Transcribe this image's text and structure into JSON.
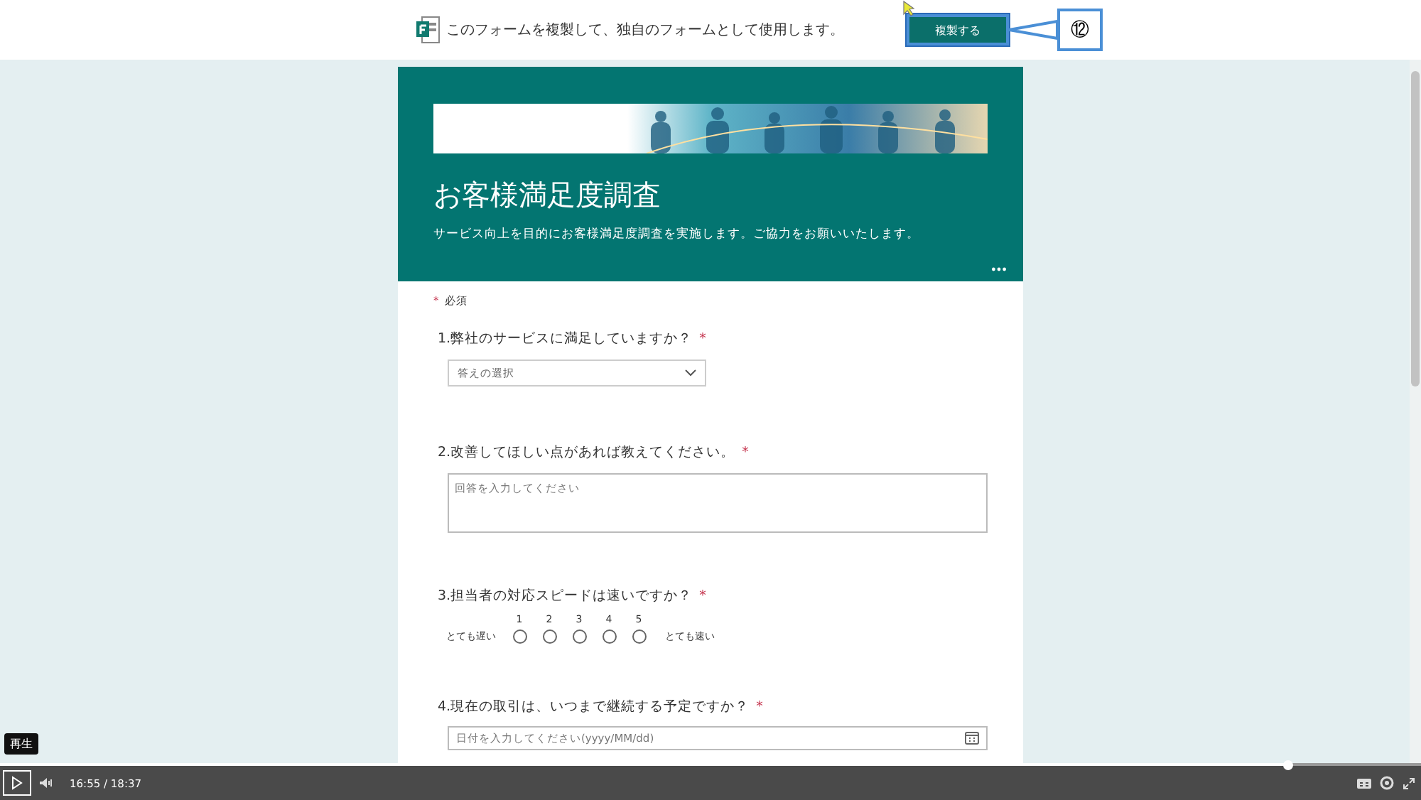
{
  "banner": {
    "text": "このフォームを複製して、独自のフォームとして使用します。",
    "button": "複製する",
    "callout": "⑫"
  },
  "form": {
    "title": "お客様満足度調査",
    "description": "サービス向上を目的にお客様満足度調査を実施します。ご協力をお願いいたします。",
    "required_note": {
      "mark": "*",
      "text": "必須"
    },
    "questions": [
      {
        "kind": "dropdown",
        "text": "1.弊社のサービスに満足していますか？",
        "mark": "*",
        "placeholder": "答えの選択"
      },
      {
        "kind": "textarea",
        "text": "2.改善してほしい点があれば教えてください。",
        "mark": "*",
        "placeholder": "回答を入力してください"
      },
      {
        "kind": "rating",
        "text": "3.担当者の対応スピードは速いですか？",
        "mark": "*",
        "low": "とても遅い",
        "high": "とても速い",
        "options": [
          {
            "label": "1",
            "selected": false
          },
          {
            "label": "2",
            "selected": false
          },
          {
            "label": "3",
            "selected": false
          },
          {
            "label": "4",
            "selected": false
          },
          {
            "label": "5",
            "selected": false
          }
        ]
      },
      {
        "kind": "date",
        "text": "4.現在の取引は、いつまで継続する予定ですか？",
        "mark": "*",
        "placeholder": "日付を入力してください(yyyy/MM/dd)"
      }
    ]
  },
  "player": {
    "tooltip": "再生",
    "current": "16:55",
    "separator": "/",
    "total": "18:37",
    "level": 0.906
  }
}
